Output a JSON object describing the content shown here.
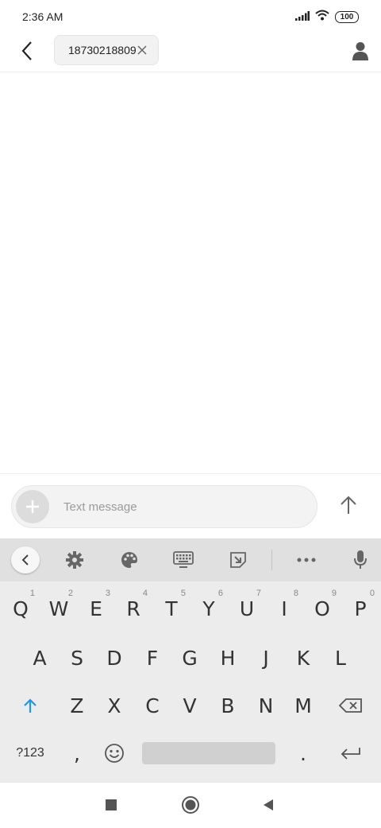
{
  "status_bar": {
    "time": "2:36 AM",
    "battery": "100"
  },
  "header": {
    "recipient": "18730218809"
  },
  "composer": {
    "placeholder": "Text message"
  },
  "keyboard": {
    "row1": [
      {
        "key": "Q",
        "hint": "1"
      },
      {
        "key": "W",
        "hint": "2"
      },
      {
        "key": "E",
        "hint": "3"
      },
      {
        "key": "R",
        "hint": "4"
      },
      {
        "key": "T",
        "hint": "5"
      },
      {
        "key": "Y",
        "hint": "6"
      },
      {
        "key": "U",
        "hint": "7"
      },
      {
        "key": "I",
        "hint": "8"
      },
      {
        "key": "O",
        "hint": "9"
      },
      {
        "key": "P",
        "hint": "0"
      }
    ],
    "row2": [
      "A",
      "S",
      "D",
      "F",
      "G",
      "H",
      "J",
      "K",
      "L"
    ],
    "row3": [
      "Z",
      "X",
      "C",
      "V",
      "B",
      "N",
      "M"
    ],
    "symbols_label": "?123",
    "comma": ",",
    "period": "."
  },
  "icons": {
    "back": "back-arrow-icon",
    "chip_close": "close-icon",
    "contact": "person-icon",
    "add": "plus-icon",
    "send": "arrow-up-icon",
    "toolbar": [
      "chevron-left-icon",
      "gear-icon",
      "palette-icon",
      "keyboard-icon",
      "resize-icon",
      "more-icon",
      "mic-icon"
    ],
    "shift": "shift-arrow-icon",
    "backspace": "backspace-icon",
    "emoji": "emoji-icon",
    "enter": "enter-icon",
    "nav": [
      "recents-square-icon",
      "home-circle-icon",
      "back-triangle-icon"
    ]
  },
  "colors": {
    "shift_accent": "#2196f3",
    "keyboard_bg": "#ececec",
    "toolbar_bg": "#e0e0e0"
  }
}
